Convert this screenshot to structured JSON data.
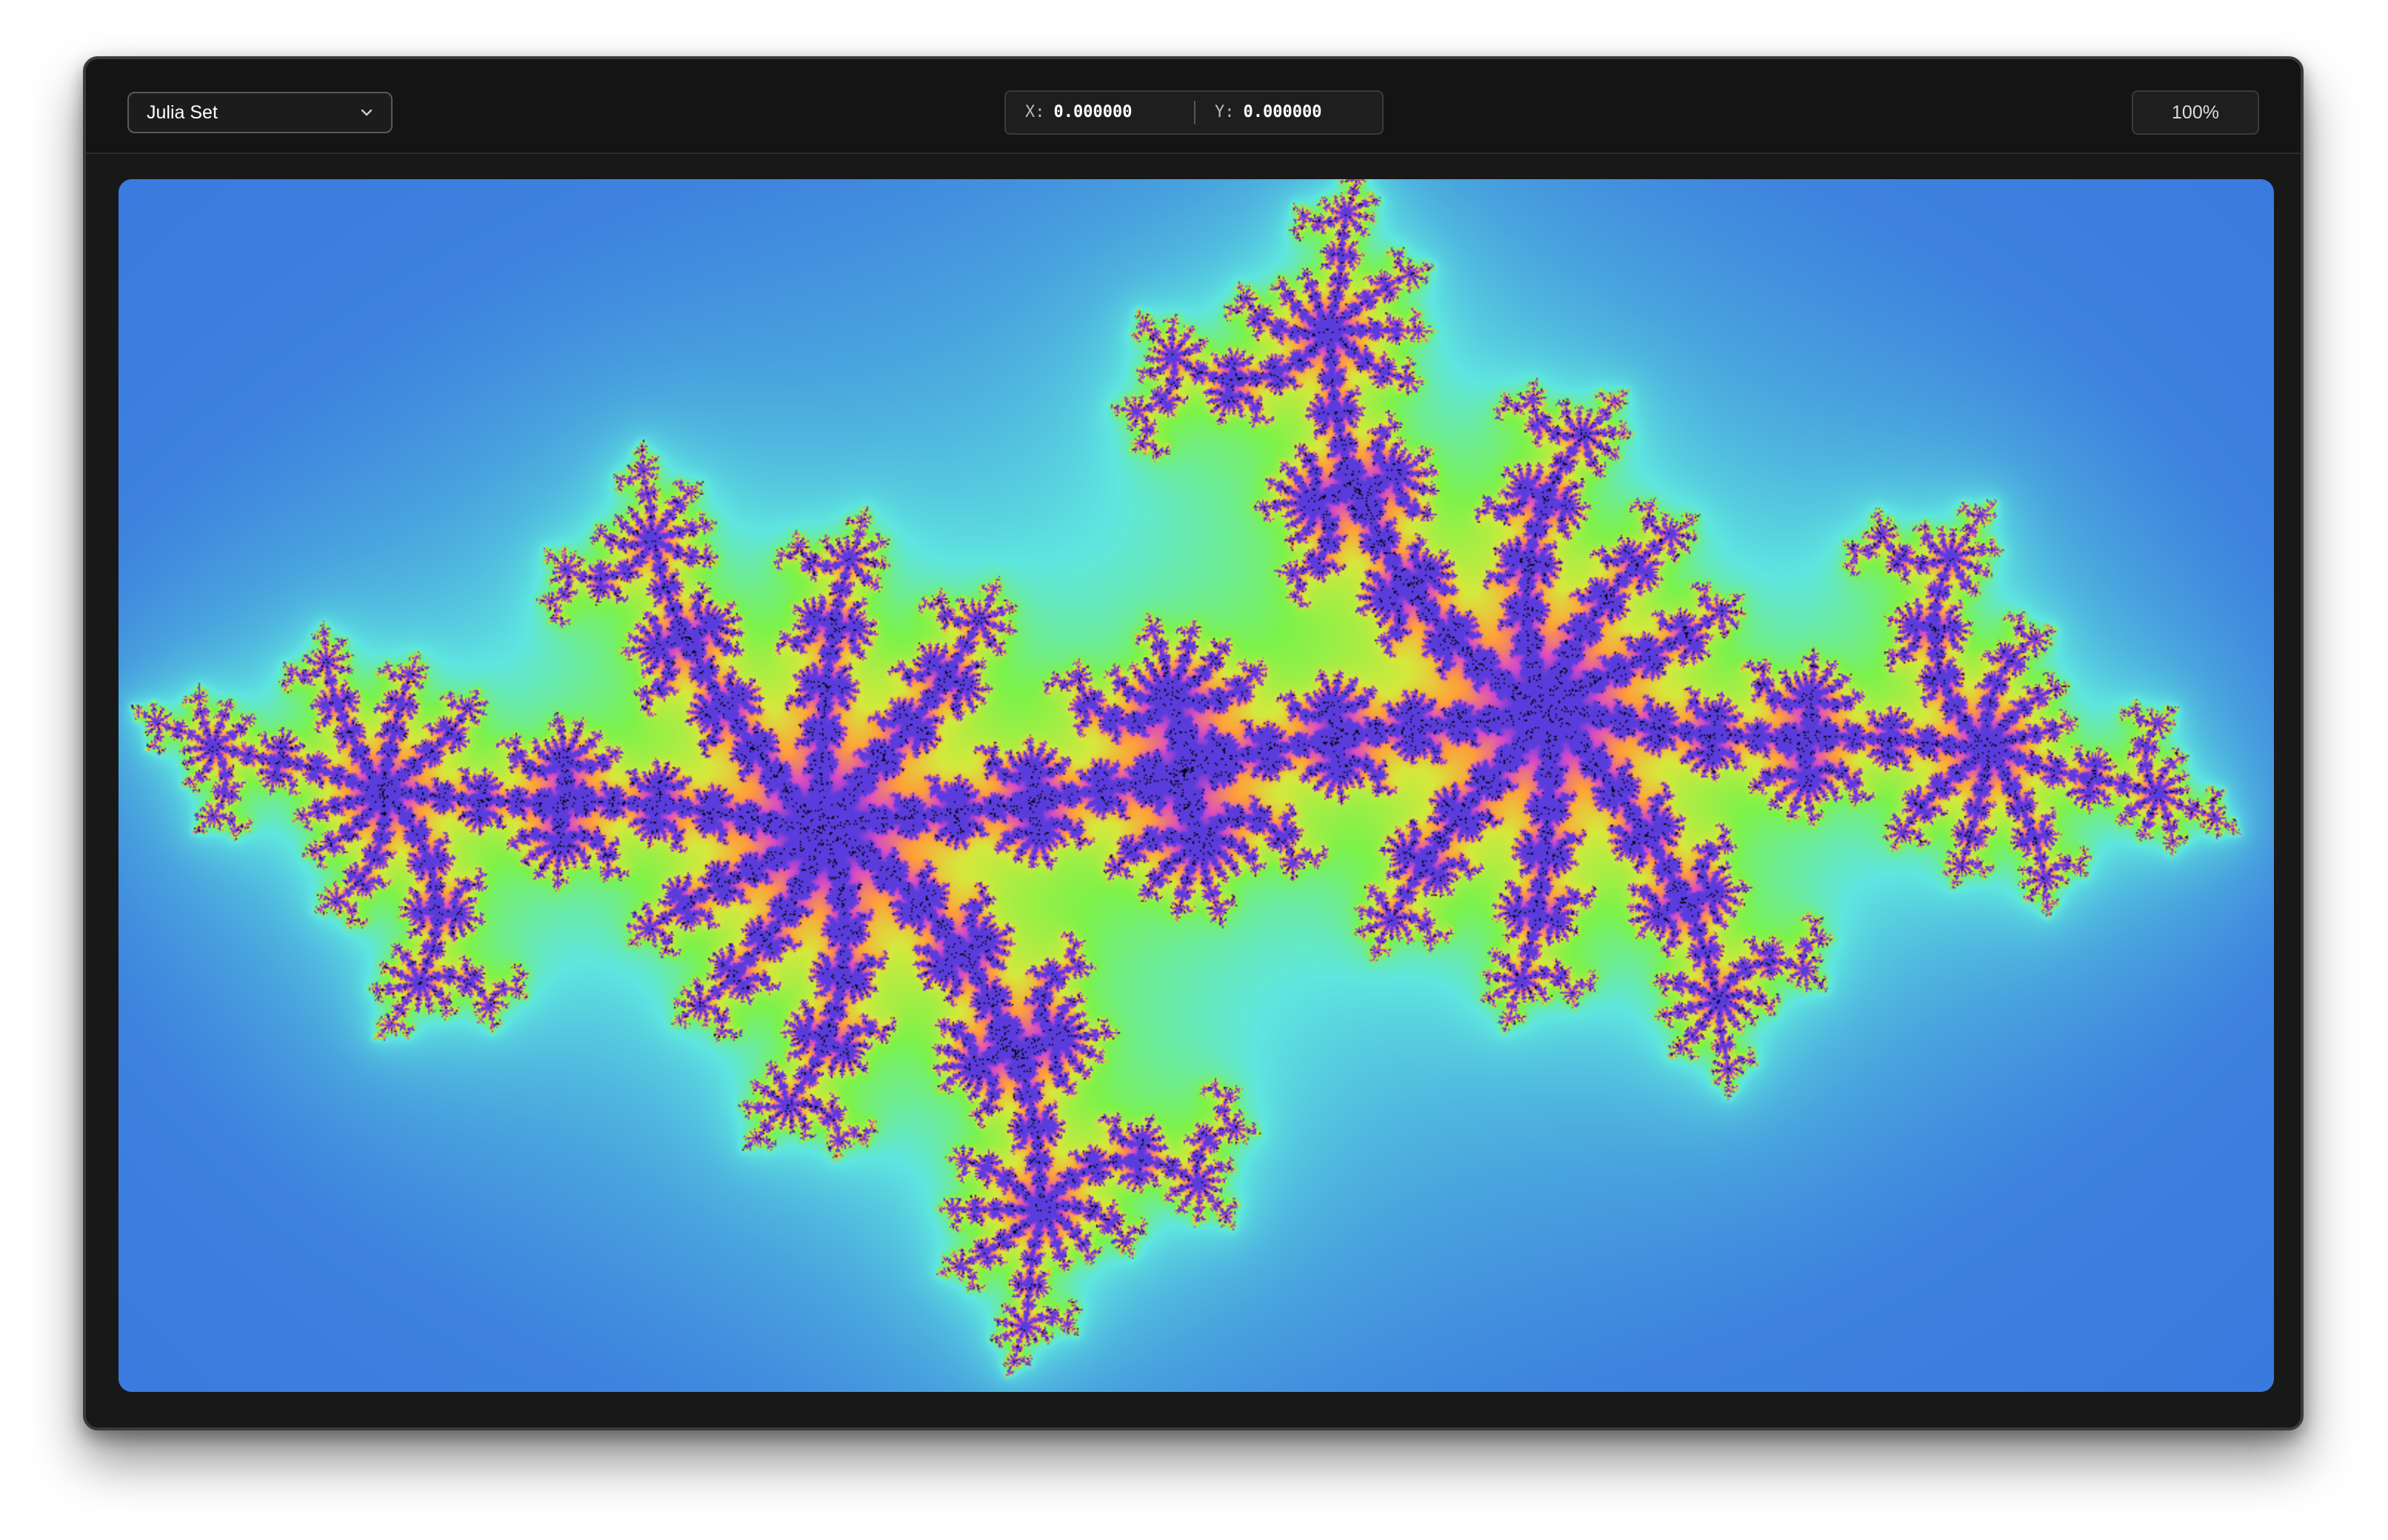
{
  "toolbar": {
    "fractal_select": {
      "selected": "Julia Set",
      "icon": "chevron-down-icon"
    },
    "coordinates": {
      "x_label": "X:",
      "x_value": "0.000000",
      "y_label": "Y:",
      "y_value": "0.000000"
    },
    "zoom_level": "100%"
  },
  "canvas": {
    "colors": {
      "interior": "#000000",
      "outer_blue": "#2f5fdc",
      "cyan_halo": "#5fe6df",
      "green_band": "#7cf24a",
      "edge_orange": "#ff9f3a",
      "edge_magenta": "#d84ac8"
    }
  }
}
